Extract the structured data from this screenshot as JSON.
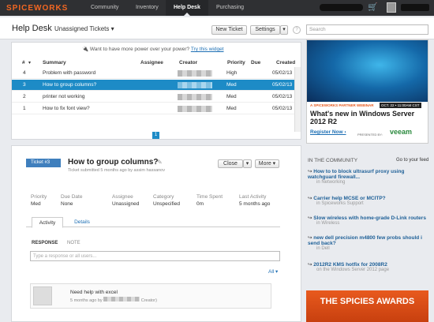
{
  "topnav": {
    "brand": "SPICEWORKS",
    "items": [
      "Community",
      "Inventory",
      "Help Desk",
      "Purchasing"
    ]
  },
  "header": {
    "title": "Help Desk",
    "view": "Unassigned Tickets",
    "new_ticket": "New Ticket",
    "settings": "Settings",
    "help": "?",
    "search_placeholder": "Search"
  },
  "promo": {
    "text": "Want to have more power over your power?",
    "link": "Try this widget"
  },
  "table": {
    "headers": [
      "#",
      "Summary",
      "Assignee",
      "Creator",
      "Priority",
      "Due",
      "Created"
    ],
    "rows": [
      {
        "id": "4",
        "summary": "Problem with password",
        "priority": "High",
        "created": "05/02/13"
      },
      {
        "id": "3",
        "summary": "How to group columns?",
        "priority": "Med",
        "created": "05/02/13"
      },
      {
        "id": "2",
        "summary": "printer not working",
        "priority": "Med",
        "created": "05/02/13"
      },
      {
        "id": "1",
        "summary": "How to fix font view?",
        "priority": "Med",
        "created": "05/02/13"
      }
    ],
    "page": "1"
  },
  "ticket": {
    "badge": "Ticket #3",
    "title": "How to group columns?",
    "subtitle": "Ticket submitted 5 months ago by assim hassanov",
    "close": "Close",
    "more": "More",
    "fields": [
      {
        "label": "Priority",
        "value": "Med"
      },
      {
        "label": "Due Date",
        "value": "None"
      },
      {
        "label": "Assignee",
        "value": "Unassigned"
      },
      {
        "label": "Category",
        "value": "Unspecified"
      },
      {
        "label": "Time Spent",
        "value": "0m"
      },
      {
        "label": "Last Activity",
        "value": "5 months ago"
      }
    ],
    "tabs": [
      "Activity",
      "Details"
    ],
    "response_tabs": [
      "RESPONSE",
      "NOTE"
    ],
    "response_placeholder": "Type a response or all users...",
    "filter": "All",
    "activity": {
      "text": "Need help with excel",
      "meta_prefix": "5 months ago by",
      "meta_suffix": "Creator)"
    }
  },
  "ad": {
    "tag": "A SPICEWORKS PARTNER WEBINAR",
    "date": "OCT. 22 • 11:00AM CST",
    "headline": "What's new in Windows Server 2012 R2",
    "cta": "Register Now",
    "presented": "PRESENTED BY:",
    "sponsor": "veeam"
  },
  "community": {
    "title": "IN THE COMMUNITY",
    "link": "Go to your feed",
    "items": [
      {
        "title": "How to to block ultrasurf proxy using watchguard firewall...",
        "sub": "in Networking"
      },
      {
        "title": "Carrier help MCSE or MCITP?",
        "sub": "in Spiceworks Support"
      },
      {
        "title": "Slow wireless with home-grade D-Link routers",
        "sub": "in Wireless"
      },
      {
        "title": "new dell precision m4800 few probs should i send back?",
        "sub": "in Dell"
      },
      {
        "title": "2012R2 KMS hotfix for 2008R2",
        "sub": "on the Windows Server 2012 page"
      }
    ]
  },
  "awards": {
    "text": "THE SPICIES AWARDS"
  }
}
